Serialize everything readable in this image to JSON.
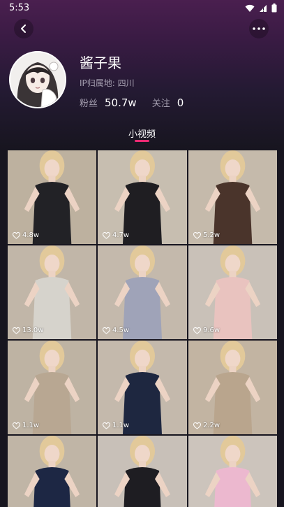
{
  "status_bar": {
    "time": "5:53",
    "icons": [
      "wifi-icon",
      "signal-icon",
      "battery-icon"
    ]
  },
  "nav": {
    "back_icon": "chevron-left-icon",
    "more_icon": "more-dots-icon"
  },
  "profile": {
    "nickname": "酱子果",
    "ip_location": "IP归属地: 四川",
    "fans_label": "粉丝",
    "fans_count": "50.7w",
    "following_label": "关注",
    "following_count": "0"
  },
  "tabs": [
    {
      "label": "小视频",
      "active": true
    }
  ],
  "colors": {
    "accent": "#ea2a72",
    "background": "#17151f"
  },
  "videos": [
    {
      "likes": "4.8w",
      "bg": "#b8ab97",
      "outfit": "#222226"
    },
    {
      "likes": "4.7w",
      "bg": "#c3b9aa",
      "outfit": "#1f1e22"
    },
    {
      "likes": "5.2w",
      "bg": "#c1b5a4",
      "outfit": "#4a342b"
    },
    {
      "likes": "13.0w",
      "bg": "#bcb0a1",
      "outfit": "#d6d3cc"
    },
    {
      "likes": "4.5w",
      "bg": "#bfb3a5",
      "outfit": "#9fa3b8"
    },
    {
      "likes": "9.6w",
      "bg": "#c5bcb2",
      "outfit": "#e9c3bf"
    },
    {
      "likes": "1.1w",
      "bg": "#b9ad9c",
      "outfit": "#b8a792"
    },
    {
      "likes": "1.1w",
      "bg": "#bfb4a5",
      "outfit": "#1e2740"
    },
    {
      "likes": "2.2w",
      "bg": "#bdae9b",
      "outfit": "#b9a58d"
    },
    {
      "likes": "",
      "bg": "#bbaf9f",
      "outfit": "#1d2744"
    },
    {
      "likes": "",
      "bg": "#c4bbb2",
      "outfit": "#1e1d22"
    },
    {
      "likes": "",
      "bg": "#c8bfb7",
      "outfit": "#ecb8cf"
    }
  ]
}
